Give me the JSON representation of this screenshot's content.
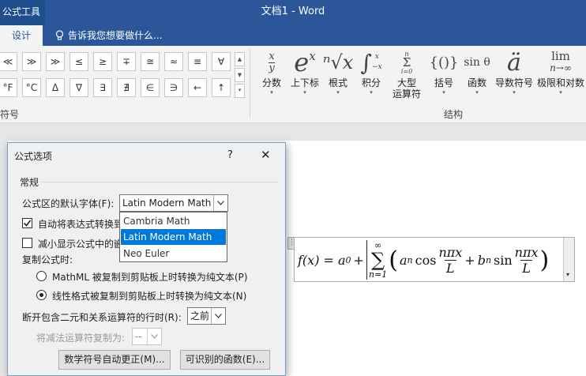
{
  "app": {
    "context_group": "公式工具",
    "doc_title": "文档1 - Word",
    "tab_active": "设计",
    "tell_me": "告诉我您想要做什么..."
  },
  "ribbon": {
    "symbols_row1": [
      "≪",
      "≫",
      "≫",
      "≤",
      "≥",
      "∓",
      "≅",
      "≈",
      "≡",
      "∀"
    ],
    "symbols_row2": [
      "°F",
      "°C",
      "Δ",
      "∇",
      "∃",
      "∄",
      "∈",
      "∋",
      "←",
      "↑"
    ],
    "group_symbols_label": "符号",
    "group_structures_label": "结构",
    "structures": [
      {
        "label": "分数",
        "label2": ""
      },
      {
        "label": "上下标",
        "label2": ""
      },
      {
        "label": "根式",
        "label2": ""
      },
      {
        "label": "积分",
        "label2": ""
      },
      {
        "label": "大型",
        "label2": "运算符"
      },
      {
        "label": "括号",
        "label2": ""
      },
      {
        "label": "函数",
        "label2": ""
      },
      {
        "label": "导数符号",
        "label2": ""
      },
      {
        "label": "极限和对数",
        "label2": ""
      }
    ],
    "structure_glyphs": {
      "radical": "ⁿ√x",
      "bracket": "{()}",
      "function": "sin θ",
      "accent": "ä",
      "limit_top": "lim",
      "limit_bottom": "n→∞",
      "integral_sup": "x",
      "integral_sub": "−x",
      "largeop_top": "n",
      "largeop_sym": "Σ",
      "largeop_bottom": "i=0",
      "superscript_base": "e",
      "superscript_exp": "x",
      "fraction_num": "x",
      "fraction_den": "y"
    }
  },
  "dialog": {
    "title": "公式选项",
    "help": "?",
    "close": "✕",
    "section": "常规",
    "default_font_label": "公式区的默认字体(F):",
    "default_font_value": "Latin Modern Math",
    "font_options": [
      "Cambria Math",
      "Latin Modern Math",
      "Neo Euler"
    ],
    "selected_font_index": 1,
    "auto_convert_label": "自动将表达式转换到",
    "auto_convert_checked": true,
    "reduce_label": "减小显示公式中的嵌",
    "reduce_checked": false,
    "copy_label": "复制公式时:",
    "radio_mathml": "MathML 被复制到剪贴板上时转换为纯文本(P)",
    "radio_linear": "线性格式被复制到剪贴板上时转换为纯文本(N)",
    "radio_selected": "linear",
    "break_label": "断开包含二元和关系运算符的行时(R):",
    "break_value": "之前",
    "minus_label": "将减法运算符复制为:",
    "minus_value": "--",
    "btn_autocorrect": "数学符号自动更正(M)...",
    "btn_functions": "可识别的函数(E)..."
  },
  "equation": {
    "lhs": "f(x) = a",
    "a0_sub": "0",
    "plus": "+",
    "sum_top": "∞",
    "sum_sym": "∑",
    "sum_bottom": "n=1",
    "an": "a",
    "an_sub": "n",
    "cos": "cos",
    "num1": "nπx",
    "den1": "L",
    "plus2": "+",
    "bn": "b",
    "bn_sub": "n",
    "sin": "sin",
    "num2": "nπx",
    "den2": "L",
    "lparen": "(",
    "rparen": ")"
  }
}
